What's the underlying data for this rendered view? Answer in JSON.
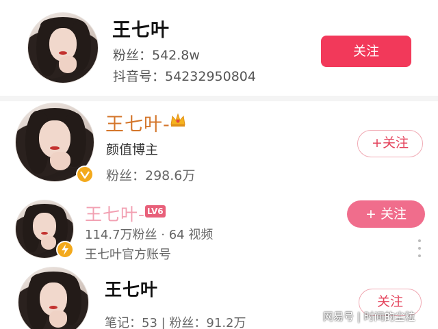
{
  "results": [
    {
      "name": "王七叶",
      "line1": "粉丝：542.8w",
      "line2": "抖音号：54232950804",
      "button": "关注"
    },
    {
      "name": "王七叶-",
      "line1": "颜值博主",
      "line2": "粉丝：298.6万",
      "button": "+关注"
    },
    {
      "name": "王七叶-",
      "level_badge": "LV6",
      "line1": "114.7万粉丝 · 64 视频",
      "line2": "王七叶官方账号",
      "button": "+ 关注"
    },
    {
      "name": "王七叶",
      "line1": "笔记：53 | 粉丝：91.2万",
      "button": "关注"
    }
  ],
  "watermark": "网易号 | 时间的尘粒",
  "colors": {
    "accent": "#f2395a",
    "name_orange": "#d4762b",
    "name_pink": "#f2a0b2",
    "verified_gold": "#f3a91c"
  }
}
